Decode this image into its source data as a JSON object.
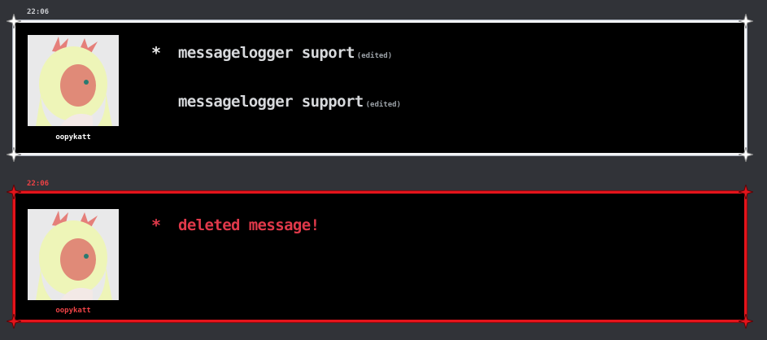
{
  "messages": [
    {
      "timestamp": "22:06",
      "username": "oopykatt",
      "lines": [
        {
          "text": "messagelogger suport",
          "edited": "(edited)"
        },
        {
          "text": "messagelogger support",
          "edited": "(edited)"
        }
      ],
      "asterisk": "*"
    },
    {
      "timestamp": "22:06",
      "username": "oopykatt",
      "lines": [
        {
          "text": "deleted message!"
        }
      ],
      "asterisk": "*"
    }
  ],
  "colors": {
    "background": "#313338",
    "box": "#000000",
    "normal_border": "#f2f3f5",
    "deleted_border": "#e4141b",
    "deleted_text": "#e0394a"
  }
}
